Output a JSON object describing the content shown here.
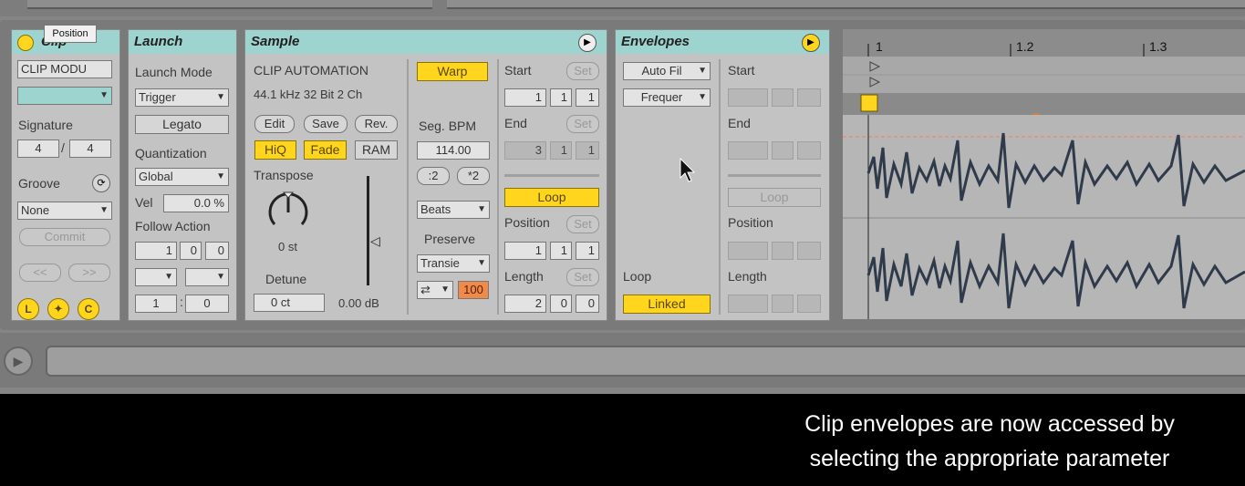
{
  "tooltip": "Position",
  "clip": {
    "title": "Clip",
    "name": "CLIP MODU",
    "signature_label": "Signature",
    "sig_num": "4",
    "sig_den": "4",
    "sig_sep": "/",
    "groove_label": "Groove",
    "groove": "None",
    "commit": "Commit",
    "nudge_back": "<<",
    "nudge_fwd": ">>",
    "btn_l": "L",
    "btn_c": "C"
  },
  "launch": {
    "title": "Launch",
    "mode_label": "Launch Mode",
    "mode": "Trigger",
    "legato": "Legato",
    "quant_label": "Quantization",
    "quant": "Global",
    "vel_label": "Vel",
    "vel": "0.0 %",
    "follow_label": "Follow Action",
    "fa": [
      "1",
      "0",
      "0"
    ],
    "chance_a": "1",
    "chance_sep": ":",
    "chance_b": "0"
  },
  "sample": {
    "title": "Sample",
    "name": "CLIP AUTOMATION",
    "info": "44.1 kHz 32 Bit 2 Ch",
    "edit": "Edit",
    "save": "Save",
    "rev": "Rev.",
    "hiq": "HiQ",
    "fade": "Fade",
    "ram": "RAM",
    "transpose_label": "Transpose",
    "transpose": "0 st",
    "detune_label": "Detune",
    "detune": "0 ct",
    "gain": "0.00 dB",
    "warp": "Warp",
    "seg_bpm_label": "Seg. BPM",
    "bpm": "114.00",
    "half": ":2",
    "double": "*2",
    "mode": "Beats",
    "preserve_label": "Preserve",
    "preserve": "Transie",
    "loop_icon": "⇄",
    "amount": "100"
  },
  "markers": {
    "start_label": "Start",
    "set": "Set",
    "start": [
      "1",
      "1",
      "1"
    ],
    "end_label": "End",
    "end": [
      "3",
      "1",
      "1"
    ],
    "loop": "Loop",
    "position_label": "Position",
    "position": [
      "1",
      "1",
      "1"
    ],
    "length_label": "Length",
    "length": [
      "2",
      "0",
      "0"
    ]
  },
  "envelopes": {
    "title": "Envelopes",
    "device": "Auto Fil",
    "param": "Frequer",
    "loop_label": "Loop",
    "linked": "Linked",
    "start_label": "Start",
    "end_label": "End",
    "loop": "Loop",
    "position_label": "Position",
    "length_label": "Length"
  },
  "ruler": {
    "marks": [
      "1",
      "1.2",
      "1.3"
    ]
  },
  "caption": {
    "line1": "Clip envelopes are now accessed by",
    "line2": "selecting the appropriate parameter"
  }
}
